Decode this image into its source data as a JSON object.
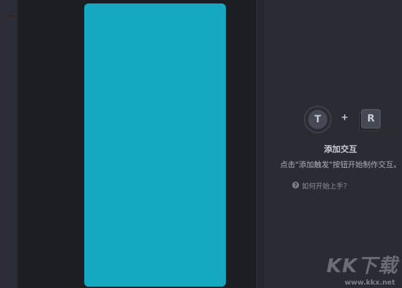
{
  "colors": {
    "canvas_bg": "#1c1e24",
    "panel_bg": "#2a2c33",
    "artboard": "#16a7c1"
  },
  "interaction_panel": {
    "trigger_badge": "T",
    "plus_sign": "+",
    "response_badge": "R",
    "title": "添加交互",
    "description": "点击\"添加触发\"按钮开始制作交互。",
    "help_icon": "?",
    "help_link": "如何开始上手？"
  },
  "watermark": {
    "logo": "KK下载",
    "url": "www.kkx.net"
  }
}
